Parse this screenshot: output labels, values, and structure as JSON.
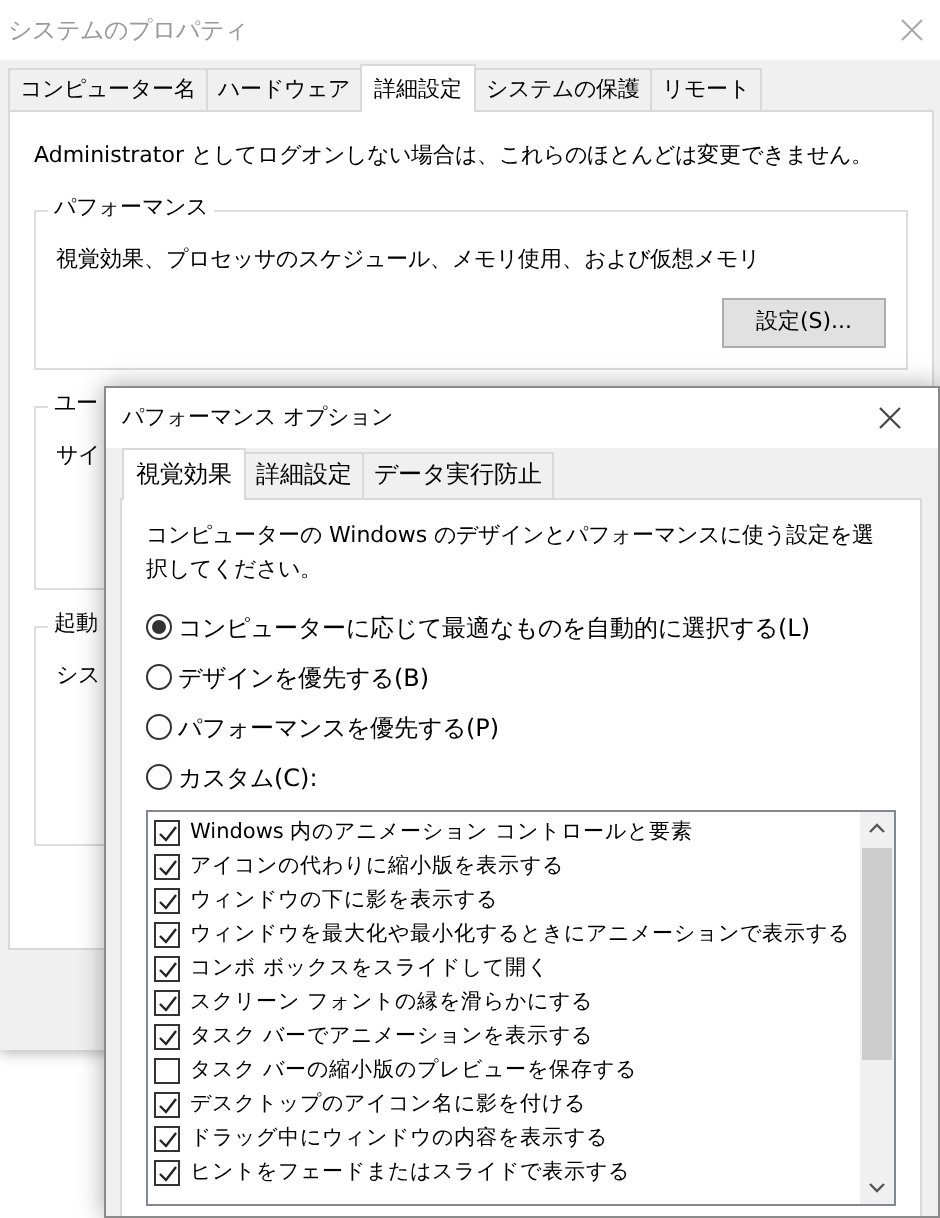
{
  "window": {
    "title": "システムのプロパティ"
  },
  "tabs": [
    {
      "label": "コンピューター名",
      "selected": false
    },
    {
      "label": "ハードウェア",
      "selected": false
    },
    {
      "label": "詳細設定",
      "selected": true
    },
    {
      "label": "システムの保護",
      "selected": false
    },
    {
      "label": "リモート",
      "selected": false
    }
  ],
  "notice": "Administrator としてログオンしない場合は、これらのほとんどは変更できません。",
  "groups": [
    {
      "title": "パフォーマンス",
      "text": "視覚効果、プロセッサのスケジュール、メモリ使用、および仮想メモリ",
      "button": "設定(S)..."
    },
    {
      "title": "ユー",
      "text": "サイ"
    },
    {
      "title": "起動",
      "text": "シス"
    }
  ],
  "dialog": {
    "title": "パフォーマンス オプション",
    "tabs": [
      {
        "label": "視覚効果",
        "selected": true
      },
      {
        "label": "詳細設定",
        "selected": false
      },
      {
        "label": "データ実行防止",
        "selected": false
      }
    ],
    "description": "コンピューターの Windows のデザインとパフォーマンスに使う設定を選択してください。",
    "options": [
      {
        "label": "コンピューターに応じて最適なものを自動的に選択する(L)",
        "selected": true
      },
      {
        "label": "デザインを優先する(B)",
        "selected": false
      },
      {
        "label": "パフォーマンスを優先する(P)",
        "selected": false
      },
      {
        "label": "カスタム(C):",
        "selected": false
      }
    ],
    "effects": [
      {
        "label": "Windows 内のアニメーション コントロールと要素",
        "checked": true
      },
      {
        "label": "アイコンの代わりに縮小版を表示する",
        "checked": true
      },
      {
        "label": "ウィンドウの下に影を表示する",
        "checked": true
      },
      {
        "label": "ウィンドウを最大化や最小化するときにアニメーションで表示する",
        "checked": true
      },
      {
        "label": "コンボ ボックスをスライドして開く",
        "checked": true
      },
      {
        "label": "スクリーン フォントの縁を滑らかにする",
        "checked": true
      },
      {
        "label": "タスク バーでアニメーションを表示する",
        "checked": true
      },
      {
        "label": "タスク バーの縮小版のプレビューを保存する",
        "checked": false
      },
      {
        "label": "デスクトップのアイコン名に影を付ける",
        "checked": true
      },
      {
        "label": "ドラッグ中にウィンドウの内容を表示する",
        "checked": true
      },
      {
        "label": "ヒントをフェードまたはスライドで表示する",
        "checked": true
      }
    ]
  }
}
